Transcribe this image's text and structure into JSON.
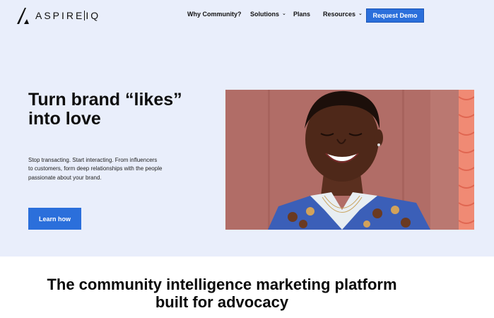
{
  "brand": {
    "name": "ASPIRE",
    "suffix": "IQ"
  },
  "nav": {
    "items": [
      {
        "label": "Why Community?",
        "dropdown": false
      },
      {
        "label": "Solutions",
        "dropdown": true
      },
      {
        "label": "Plans",
        "dropdown": false
      },
      {
        "label": "Resources",
        "dropdown": true
      }
    ],
    "cta_label": "Request Demo"
  },
  "hero": {
    "headline": "Turn brand “likes” into love",
    "subtext": "Stop transacting. Start interacting. From influencers to customers, form deep relationships with the people passionate about your brand.",
    "cta_label": "Learn how",
    "image": "smiling-woman-photo"
  },
  "platform": {
    "title_line1": "The community intelligence marketing platform",
    "title_line2": "built for advocacy"
  },
  "colors": {
    "page_bg": "#e9eefb",
    "accent": "#2b6fdb",
    "photo_bg": "#b5746d",
    "photo_stripe": "#f08a74"
  }
}
